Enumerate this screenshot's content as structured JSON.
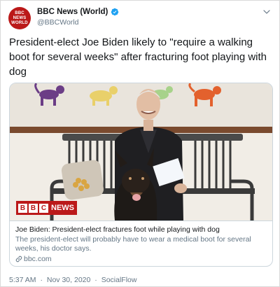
{
  "account": {
    "display_name": "BBC News (World)",
    "handle": "@BBCWorld",
    "avatar_lines": [
      "BBC",
      "NEWS",
      "WORLD"
    ],
    "verified": true
  },
  "tweet": {
    "text": "President-elect Joe Biden likely to \"require a walking boot for several weeks\" after fracturing foot playing with dog"
  },
  "card": {
    "image_logo": {
      "blocks": [
        "B",
        "B",
        "C"
      ],
      "word": "NEWS"
    },
    "title": "Joe Biden: President-elect fractures foot while playing with dog",
    "description": "The president-elect will probably have to wear a medical boot for several weeks, his doctor says.",
    "domain": "bbc.com"
  },
  "meta": {
    "time": "5:37 AM",
    "date": "Nov 30, 2020",
    "separator": "·",
    "source": "SocialFlow"
  },
  "colors": {
    "brand_red": "#bb1919",
    "verified_blue": "#1da1f2",
    "text_primary": "#14171a",
    "text_secondary": "#657786",
    "border": "#ccd6dd"
  },
  "icons": [
    "verified-badge-icon",
    "chevron-down-icon",
    "link-icon"
  ]
}
